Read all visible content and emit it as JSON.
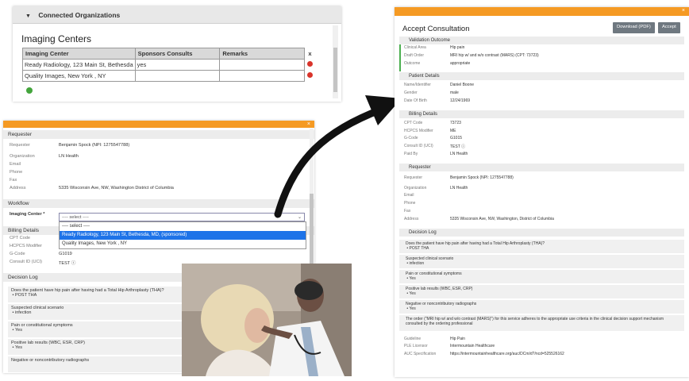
{
  "panel1": {
    "header": "Connected Organizations",
    "title": "Imaging Centers",
    "columns": [
      "Imaging Center",
      "Sponsors Consults",
      "Remarks",
      "x"
    ],
    "rows": [
      {
        "center": "Ready Radiology, 123 Main St, Bethesda",
        "sponsors": "yes",
        "remarks": ""
      },
      {
        "center": "Quality Images, New York , NY",
        "sponsors": "",
        "remarks": ""
      }
    ]
  },
  "panel2": {
    "close": "×",
    "requester_section": "Requester",
    "requester": [
      {
        "label": "Requester",
        "value": "Benjamin Spock (NPI: 1275547788)"
      },
      {
        "label": "Organization",
        "value": "LN Health"
      },
      {
        "label": "Email",
        "value": ""
      },
      {
        "label": "Phone",
        "value": ""
      },
      {
        "label": "Fax",
        "value": ""
      },
      {
        "label": "Address",
        "value": "5335 Wisconsin Ave, NW, Washington District of Columbia"
      }
    ],
    "workflow_section": "Workflow",
    "imaging_center_label": "Imaging Center *",
    "select_value": "---- select ----",
    "dropdown_options": [
      "---- select ----",
      "Ready Radiology, 123 Main St, Bethesda, MD, (sponsored)",
      "Quality Images, New York , NY"
    ],
    "billing_section": "Billing Details",
    "billing": [
      {
        "label": "CPT Code",
        "value": ""
      },
      {
        "label": "HCPCS Modifier",
        "value": "ME"
      },
      {
        "label": "G-Code",
        "value": "G1019"
      },
      {
        "label": "Consult ID (UCI)",
        "value": "TEST ⓘ"
      }
    ],
    "decision_section": "Decision Log",
    "decisions": [
      {
        "q": "Does the patient have hip pain after having had a Total Hip Arthroplasty (THA)?",
        "a": "POST THA"
      },
      {
        "q": "Suspected clinical scenario",
        "a": "infection"
      },
      {
        "q": "Pain or constitutional symptoms",
        "a": "Yes"
      },
      {
        "q": "Positive lab results (WBC, ESR, CRP)",
        "a": "Yes"
      },
      {
        "q": "Negative or noncontributory radiographs",
        "a": ""
      }
    ]
  },
  "panel3": {
    "close": "×",
    "title": "Accept Consultation",
    "download_label": "Download (PDF)",
    "accept_label": "Accept",
    "validation_section": "Validation Outcome",
    "validation": [
      {
        "label": "Clinical Area",
        "value": "Hip pain"
      },
      {
        "label": "Draft Order",
        "value": "MRI hip w/ and w/o contrast (MARS) (CPT: 73723)"
      },
      {
        "label": "Outcome",
        "value": "appropriate"
      }
    ],
    "patient_section": "Patient Details",
    "patient": [
      {
        "label": "Name/Identifier",
        "value": "Daniel Boone"
      },
      {
        "label": "Gender",
        "value": "male"
      },
      {
        "label": "Date Of Birth",
        "value": "12/24/1969"
      }
    ],
    "billing_section": "Billing Details",
    "billing": [
      {
        "label": "CPT Code",
        "value": "73723"
      },
      {
        "label": "HCPCS Modifier",
        "value": "ME"
      },
      {
        "label": "G-Code",
        "value": "G1015"
      },
      {
        "label": "Consult ID (UCI)",
        "value": "TEST ⓘ"
      },
      {
        "label": "Paid By",
        "value": "LN Health"
      }
    ],
    "requester_section": "Requester",
    "requester": [
      {
        "label": "Requester",
        "value": "Benjamin Spock (NPI: 1275547788)"
      },
      {
        "label": "Organization",
        "value": "LN Health"
      },
      {
        "label": "Email",
        "value": ""
      },
      {
        "label": "Phone",
        "value": ""
      },
      {
        "label": "Fax",
        "value": ""
      },
      {
        "label": "Address",
        "value": "5335 Wisconsin Ave, NW, Washington, District of Columbia"
      }
    ],
    "decision_section": "Decision Log",
    "decisions": [
      {
        "q": "Does the patient have hip pain after having had a Total Hip Arthroplasty (THA)?",
        "a": "POST THA"
      },
      {
        "q": "Suspected clinical scenario",
        "a": "infection"
      },
      {
        "q": "Pain or constitutional symptoms",
        "a": "Yes"
      },
      {
        "q": "Positive lab results (WBC, ESR, CRP)",
        "a": "Yes"
      },
      {
        "q": "Negative or noncontributory radiographs",
        "a": "Yes"
      }
    ],
    "order_statement": "The order (\"MRI hip w/ and w/o contrast (MARS)\") for this service adheres to the appropriate use criteria in the clinical decision support mechanism consulted by the ordering professional",
    "footer": [
      {
        "label": "Guideline",
        "value": "Hip Pain"
      },
      {
        "label": "PLE Licensor",
        "value": "Intermountain Healthcare"
      },
      {
        "label": "AUC Specification",
        "value": "https://intermountainhealthcare.org/auc/DCm/d?/ncd=525526162"
      }
    ]
  },
  "colors": {
    "accent": "#f59a23",
    "button": "#6f7880",
    "highlight": "#1e73e8",
    "remove": "#d9342b",
    "add": "#44a53d"
  }
}
